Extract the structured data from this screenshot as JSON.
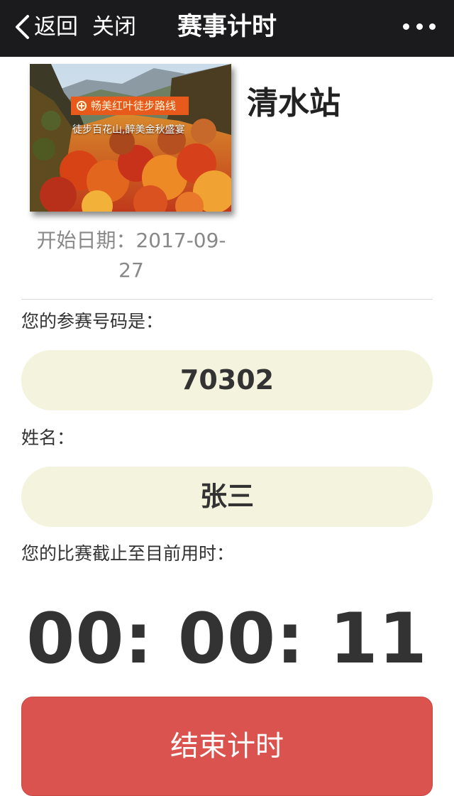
{
  "nav": {
    "back_label": "返回",
    "close_label": "关闭",
    "title": "赛事计时",
    "more_icon": "more-dots-icon",
    "back_icon": "chevron-left-icon"
  },
  "event": {
    "image": {
      "banner_text": "畅美红叶徒步路线",
      "caption": "徒步百花山,醉美金秋盛宴"
    },
    "station_name": "清水站",
    "start_date_line1": "开始日期：2017-09-",
    "start_date_line2": "27"
  },
  "entry": {
    "bib_label": "您的参赛号码是：",
    "bib_number": "70302",
    "name_label": "姓名：",
    "name_value": "张三",
    "elapsed_label": "您的比赛截止至目前用时：",
    "elapsed_time": "00: 00: 11"
  },
  "actions": {
    "end_timing_label": "结束计时"
  },
  "colors": {
    "navbar_bg": "#1b1b1d",
    "pill_bg": "#f4f4de",
    "button_bg": "#da534f",
    "banner_bg": "#e85a1c"
  }
}
